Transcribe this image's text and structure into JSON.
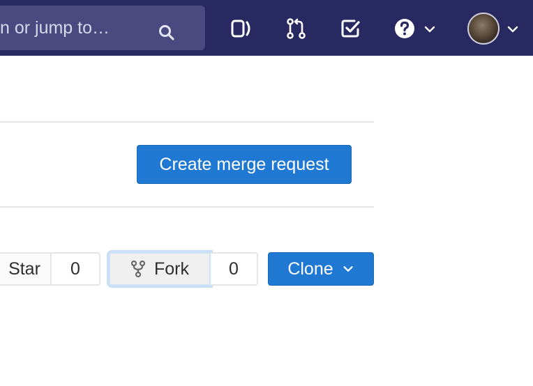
{
  "navbar": {
    "search_placeholder": "Search or jump to…",
    "search_visible_text": "n or jump to…",
    "icons": [
      "search-icon",
      "sidebar-toggle-icon",
      "merge-requests-icon",
      "todos-icon",
      "help-icon",
      "chevron-down-icon",
      "avatar",
      "chevron-down-icon"
    ]
  },
  "actions": {
    "create_merge_request_label": "Create merge request"
  },
  "project_buttons": {
    "star_label": "Star",
    "star_count": "0",
    "fork_label": "Fork",
    "fork_count": "0",
    "clone_label": "Clone"
  },
  "colors": {
    "navbar_bg": "#292961",
    "search_bg": "#4a4a80",
    "primary": "#1f78d1"
  }
}
